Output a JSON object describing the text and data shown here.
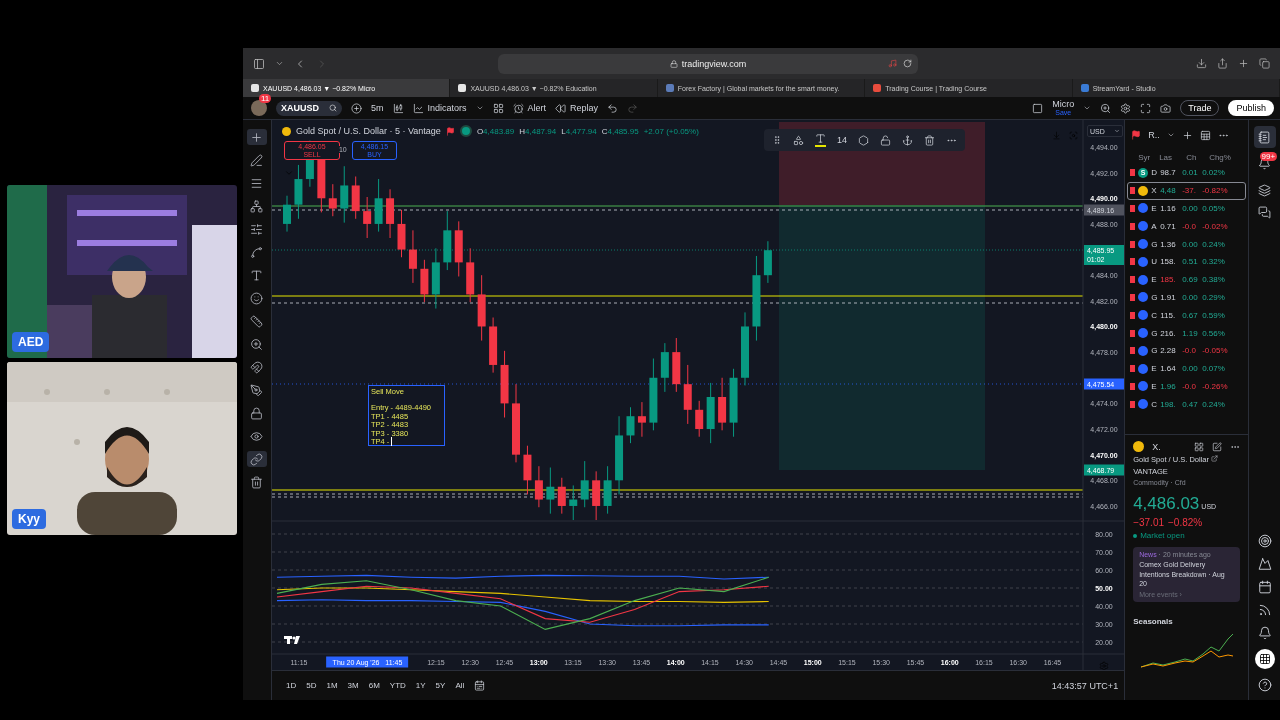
{
  "video_tiles": [
    {
      "label": "AED",
      "kind": "studio"
    },
    {
      "label": "Kyy",
      "kind": "wall"
    }
  ],
  "browser": {
    "address": "tradingview.com",
    "tabs": [
      {
        "title": "XAUUSD 4,486.03 ▼ −0.82% Micro",
        "kind": "tv",
        "selected": true
      },
      {
        "title": "XAUUSD 4,486.03 ▼ −0.82% Education",
        "kind": "tv",
        "selected": false
      },
      {
        "title": "Forex Factory | Global markets for the smart money.",
        "kind": "ff",
        "selected": false
      },
      {
        "title": "Trading Course | Trading Course",
        "kind": "tc",
        "selected": false
      },
      {
        "title": "StreamYard - Studio",
        "kind": "sy",
        "selected": false
      }
    ]
  },
  "toolbar": {
    "avatar_badge": "11",
    "symbol": "XAUUSD",
    "interval": "5m",
    "indicators": "Indicators",
    "alert": "Alert",
    "replay": "Replay",
    "layout_name": "Micro",
    "layout_status": "Save",
    "trade": "Trade",
    "publish": "Publish"
  },
  "chart": {
    "legend": {
      "title": "Gold Spot / U.S. Dollar · 5 · Vantage",
      "ohlc": [
        {
          "label": "O",
          "value": "4,483.89"
        },
        {
          "label": "H",
          "value": "4,487.94"
        },
        {
          "label": "L",
          "value": "4,477.94"
        },
        {
          "label": "C",
          "value": "4,485.95"
        }
      ],
      "change": "+2.07 (+0.05%)"
    },
    "sell": {
      "price": "4,486.05",
      "label": "SELL"
    },
    "buy": {
      "price": "4,486.15",
      "label": "BUY"
    },
    "bar_marker": "10",
    "drawing_toolbar": {
      "font_size": "14"
    },
    "note": {
      "title": "Sell Move",
      "lines": [
        "Entry - 4489-4490",
        "TP1 - 4485",
        "TP2 - 4483",
        "TP3 - 3380",
        "TP4 -"
      ]
    },
    "currency": "USD",
    "price_ticks": [
      {
        "label": "4,494.00",
        "major": false
      },
      {
        "label": "4,492.00",
        "major": false
      },
      {
        "label": "4,490.00",
        "major": true
      },
      {
        "label": "4,488.00",
        "major": false
      },
      {
        "label": "4,484.00",
        "major": false
      },
      {
        "label": "4,482.00",
        "major": false
      },
      {
        "label": "4,480.00",
        "major": true
      },
      {
        "label": "4,478.00",
        "major": false
      },
      {
        "label": "4,474.00",
        "major": false
      },
      {
        "label": "4,472.00",
        "major": false
      },
      {
        "label": "4,470.00",
        "major": true
      },
      {
        "label": "4,468.00",
        "major": false
      },
      {
        "label": "4,466.00",
        "major": false
      }
    ],
    "price_tags": [
      {
        "text": "4,489.16",
        "kind": "crosshair"
      },
      {
        "text": "4,485.95",
        "sub": "01:02",
        "kind": "last"
      },
      {
        "text": "4,475.54",
        "kind": "line"
      },
      {
        "text": "4,468.79",
        "kind": "level"
      }
    ],
    "oscillator_ticks": [
      {
        "label": "80.00",
        "major": false
      },
      {
        "label": "70.00",
        "major": false
      },
      {
        "label": "60.00",
        "major": false
      },
      {
        "label": "50.00",
        "major": true
      },
      {
        "label": "40.00",
        "major": false
      },
      {
        "label": "30.00",
        "major": false
      },
      {
        "label": "20.00",
        "major": false
      }
    ],
    "time_ticks": [
      {
        "label": "11:15",
        "kind": "tick",
        "major": false
      },
      {
        "label": "Thu 20 Aug '26   11:45",
        "kind": "cursor",
        "major": false
      },
      {
        "label": "12:15",
        "kind": "tick",
        "major": false
      },
      {
        "label": "12:30",
        "kind": "tick",
        "major": false
      },
      {
        "label": "12:45",
        "kind": "tick",
        "major": false
      },
      {
        "label": "13:00",
        "kind": "tick",
        "major": true
      },
      {
        "label": "13:15",
        "kind": "tick",
        "major": false
      },
      {
        "label": "13:30",
        "kind": "tick",
        "major": false
      },
      {
        "label": "13:45",
        "kind": "tick",
        "major": false
      },
      {
        "label": "14:00",
        "kind": "tick",
        "major": true
      },
      {
        "label": "14:15",
        "kind": "tick",
        "major": false
      },
      {
        "label": "14:30",
        "kind": "tick",
        "major": false
      },
      {
        "label": "14:45",
        "kind": "tick",
        "major": false
      },
      {
        "label": "15:00",
        "kind": "tick",
        "major": true
      },
      {
        "label": "15:15",
        "kind": "tick",
        "major": false
      },
      {
        "label": "15:30",
        "kind": "tick",
        "major": false
      },
      {
        "label": "15:45",
        "kind": "tick",
        "major": false
      },
      {
        "label": "16:00",
        "kind": "tick",
        "major": true
      },
      {
        "label": "16:15",
        "kind": "tick",
        "major": false
      },
      {
        "label": "16:30",
        "kind": "tick",
        "major": false
      },
      {
        "label": "16:45",
        "kind": "tick",
        "major": false
      }
    ],
    "ranges": [
      "1D",
      "5D",
      "1M",
      "3M",
      "6M",
      "YTD",
      "1Y",
      "5Y",
      "All"
    ],
    "clock": "14:43:57 UTC+1"
  },
  "watchlist": {
    "title": "R..",
    "columns": [
      "Syr",
      "Las",
      "Ch",
      "Chg%"
    ],
    "rows": [
      {
        "kind": "letter",
        "badge": "S",
        "symbol": "D",
        "last": "98.7",
        "change": "0.01",
        "change_pct": "0.02%",
        "falling": false,
        "last_ticked_up": false,
        "last_ticked_down": false,
        "selected": false
      },
      {
        "kind": "coin",
        "symbol": "X",
        "last": "4,48",
        "change": "-37.",
        "change_pct": "-0.82%",
        "falling": true,
        "last_ticked_up": true,
        "last_ticked_down": false,
        "selected": true
      },
      {
        "kind": "pair",
        "symbol": "E",
        "last": "1.16",
        "change": "0.00",
        "change_pct": "0.05%",
        "falling": false,
        "last_ticked_up": false,
        "last_ticked_down": false,
        "selected": false
      },
      {
        "kind": "pair",
        "symbol": "A",
        "last": "0.71",
        "change": "-0.0",
        "change_pct": "-0.02%",
        "falling": true,
        "last_ticked_up": false,
        "last_ticked_down": false,
        "selected": false
      },
      {
        "kind": "pair",
        "symbol": "G",
        "last": "1.36",
        "change": "0.00",
        "change_pct": "0.24%",
        "falling": false,
        "last_ticked_up": false,
        "last_ticked_down": false,
        "selected": false
      },
      {
        "kind": "pair",
        "symbol": "U",
        "last": "158.",
        "change": "0.51",
        "change_pct": "0.32%",
        "falling": false,
        "last_ticked_up": false,
        "last_ticked_down": false,
        "selected": false
      },
      {
        "kind": "pair",
        "symbol": "E",
        "last": "185.",
        "change": "0.69",
        "change_pct": "0.38%",
        "falling": false,
        "last_ticked_up": false,
        "last_ticked_down": true,
        "selected": false
      },
      {
        "kind": "pair",
        "symbol": "G",
        "last": "1.91",
        "change": "0.00",
        "change_pct": "0.29%",
        "falling": false,
        "last_ticked_up": false,
        "last_ticked_down": false,
        "selected": false
      },
      {
        "kind": "pair",
        "symbol": "C",
        "last": "115.",
        "change": "0.67",
        "change_pct": "0.59%",
        "falling": false,
        "last_ticked_up": false,
        "last_ticked_down": false,
        "selected": false
      },
      {
        "kind": "pair",
        "symbol": "G",
        "last": "216.",
        "change": "1.19",
        "change_pct": "0.56%",
        "falling": false,
        "last_ticked_up": false,
        "last_ticked_down": false,
        "selected": false
      },
      {
        "kind": "pair",
        "symbol": "G",
        "last": "2.28",
        "change": "-0.0",
        "change_pct": "-0.05%",
        "falling": true,
        "last_ticked_up": false,
        "last_ticked_down": false,
        "selected": false
      },
      {
        "kind": "pair",
        "symbol": "E",
        "last": "1.64",
        "change": "0.00",
        "change_pct": "0.07%",
        "falling": false,
        "last_ticked_up": false,
        "last_ticked_down": false,
        "selected": false
      },
      {
        "kind": "pair",
        "symbol": "E",
        "last": "1.96",
        "change": "-0.0",
        "change_pct": "-0.26%",
        "falling": true,
        "last_ticked_up": true,
        "last_ticked_down": false,
        "selected": false
      },
      {
        "kind": "pair",
        "symbol": "C",
        "last": "198.",
        "change": "0.47",
        "change_pct": "0.24%",
        "falling": false,
        "last_ticked_up": true,
        "last_ticked_down": false,
        "selected": false
      }
    ]
  },
  "details": {
    "symbol": "X.",
    "name": "Gold Spot / U.S. Dollar",
    "exchange": "VANTAGE",
    "type": "Commodity · Cfd",
    "price": "4,486.03",
    "currency": "USD",
    "change": "−37.01",
    "change_pct": "−0.82%",
    "status": "Market open",
    "news": {
      "source": "News",
      "time": "· 20 minutes ago",
      "headline": "Comex Gold Delivery Intentions Breakdown · Aug 20",
      "more": "More events ›"
    },
    "seasonals": "Seasonals"
  },
  "side_badge": "99+"
}
